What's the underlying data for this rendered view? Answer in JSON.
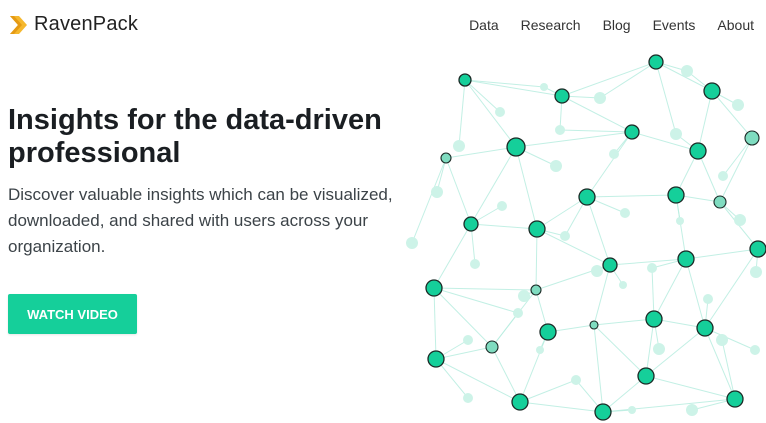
{
  "brand": {
    "name": "RavenPack",
    "accent": "#15cf9a",
    "logo_color": "#f5b82e"
  },
  "nav": {
    "items": [
      {
        "label": "Data"
      },
      {
        "label": "Research"
      },
      {
        "label": "Blog"
      },
      {
        "label": "Events"
      },
      {
        "label": "About"
      }
    ]
  },
  "hero": {
    "title_line1": "Insights for the data-driven",
    "title_line2": "professional",
    "subtitle_line1": "Discover valuable insights which can be visualized,",
    "subtitle_line2": "downloaded, and shared with users across your",
    "subtitle_line3": "organization.",
    "cta_label": "WATCH VIDEO"
  },
  "illustration": {
    "icon": "network-graph-icon",
    "node_color": "#15cf9a",
    "edge_color": "#b8ede0"
  }
}
